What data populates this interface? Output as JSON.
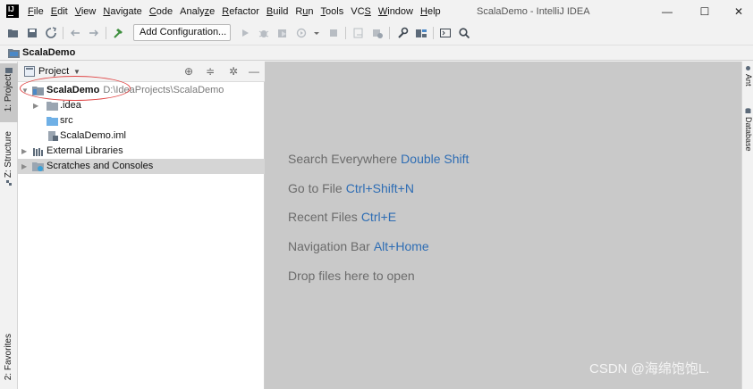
{
  "title_bar": {
    "menu": [
      {
        "label": "File",
        "mnemonic": "F"
      },
      {
        "label": "Edit",
        "mnemonic": "E"
      },
      {
        "label": "View",
        "mnemonic": "V"
      },
      {
        "label": "Navigate",
        "mnemonic": "N"
      },
      {
        "label": "Code",
        "mnemonic": "C"
      },
      {
        "label": "Analyze",
        "mnemonic": "z"
      },
      {
        "label": "Refactor",
        "mnemonic": "R"
      },
      {
        "label": "Build",
        "mnemonic": "B"
      },
      {
        "label": "Run",
        "mnemonic": "u"
      },
      {
        "label": "Tools",
        "mnemonic": "T"
      },
      {
        "label": "VCS",
        "mnemonic": "S"
      },
      {
        "label": "Window",
        "mnemonic": "W"
      },
      {
        "label": "Help",
        "mnemonic": "H"
      }
    ],
    "window_title": "ScalaDemo - IntelliJ IDEA",
    "minimize": "—",
    "maximize": "☐",
    "close": "✕"
  },
  "toolbar": {
    "add_configuration": "Add Configuration..."
  },
  "navbar": {
    "project": "ScalaDemo"
  },
  "left_strip": {
    "project_tab": "1: Project",
    "structure_tab": "Z: Structure",
    "favorites_tab": "2: Favorites"
  },
  "project_panel": {
    "title": "Project",
    "tree": [
      {
        "label": "ScalaDemo",
        "path": "D:\\IdeaProjects\\ScalaDemo"
      },
      {
        "label": ".idea"
      },
      {
        "label": "src"
      },
      {
        "label": "ScalaDemo.iml"
      },
      {
        "label": "External Libraries"
      },
      {
        "label": "Scratches and Consoles"
      }
    ]
  },
  "editor": {
    "hints": [
      {
        "text": "Search Everywhere",
        "shortcut": "Double Shift"
      },
      {
        "text": "Go to File",
        "shortcut": "Ctrl+Shift+N"
      },
      {
        "text": "Recent Files",
        "shortcut": "Ctrl+E"
      },
      {
        "text": "Navigation Bar",
        "shortcut": "Alt+Home"
      },
      {
        "text": "Drop files here to open",
        "shortcut": ""
      }
    ],
    "watermark": "CSDN @海绵饱饱L."
  },
  "right_strip": {
    "ant_tab": "Ant",
    "database_tab": "Database"
  },
  "colors": {
    "accent_shortcut": "#2e6db4",
    "editor_bg": "#c9c9c9",
    "annotation_circle": "#e04545"
  }
}
